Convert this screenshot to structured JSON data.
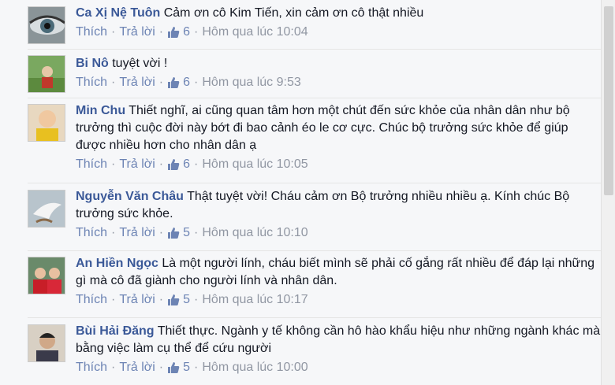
{
  "colors": {
    "author": "#3b5998",
    "link": "#6d84b4",
    "meta": "#9197a3",
    "text": "#141823"
  },
  "labels": {
    "like": "Thích",
    "reply": "Trả lời",
    "separator": "·"
  },
  "comments": [
    {
      "author": "Ca Xị Nệ Tuôn",
      "text": "Cảm ơn cô Kim Tiến, xin cảm ơn cô thật nhiều",
      "likes": "6",
      "time": "Hôm qua lúc 10:04"
    },
    {
      "author": "Bi Nô",
      "text": "tuyệt vời !",
      "likes": "6",
      "time": "Hôm qua lúc 9:53"
    },
    {
      "author": "Min Chu",
      "text": "Thiết nghĩ, ai cũng quan tâm hơn một chút đến sức khỏe của nhân dân như bộ trưởng thì cuộc đời này bớt đi bao cảnh éo le cơ cực. Chúc bộ trưởng sức khỏe để giúp được nhiều hơn cho nhân dân ạ",
      "likes": "6",
      "time": "Hôm qua lúc 10:05"
    },
    {
      "author": "Nguyễn Văn Châu",
      "text": "Thật tuyệt vời! Cháu cảm ơn Bộ trưởng nhiều nhiều ạ. Kính chúc Bộ trưởng sức khỏe.",
      "likes": "5",
      "time": "Hôm qua lúc 10:10"
    },
    {
      "author": "An Hiền Ngọc",
      "text": "Là một người lính, cháu biết mình sẽ phải cố gắng rất nhiều để đáp lại những gì mà cô đã giành cho người lính và nhân dân.",
      "likes": "5",
      "time": "Hôm qua lúc 10:17"
    },
    {
      "author": "Bùi Hải Đăng",
      "text": "Thiết thực. Ngành y tế không cần hô hào khẩu hiệu như những ngành khác mà bằng việc làm cụ thể để cứu người",
      "likes": "5",
      "time": "Hôm qua lúc 10:00"
    }
  ]
}
